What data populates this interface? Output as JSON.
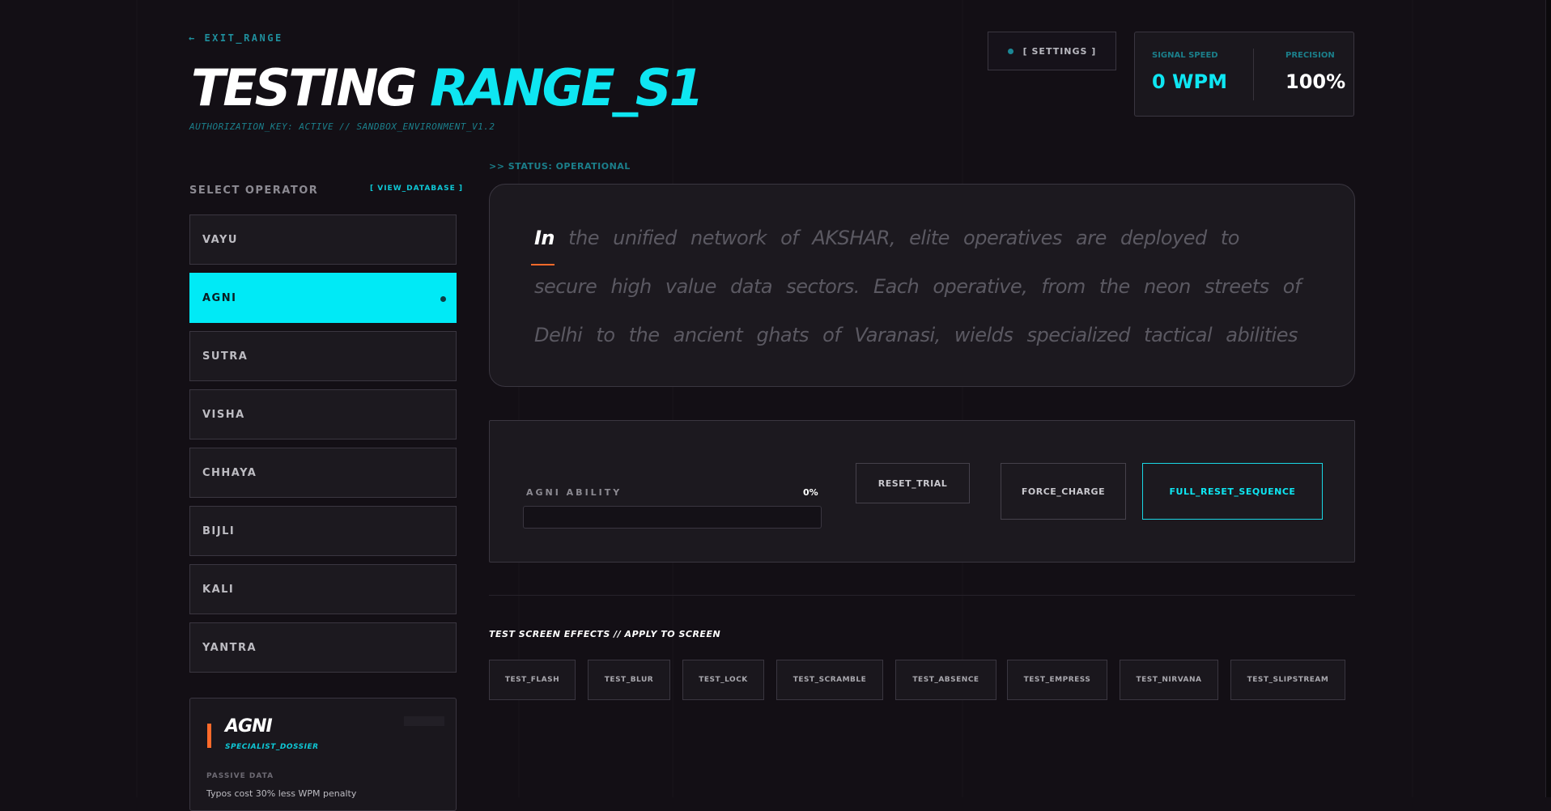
{
  "header": {
    "exit_label": "← EXIT_RANGE",
    "title_white": "TESTING",
    "title_cyan": "RANGE_S1",
    "auth_line": "AUTHORIZATION_KEY: ACTIVE // SANDBOX_ENVIRONMENT_V1.2",
    "settings_label": "[ SETTINGS ]"
  },
  "stats": {
    "speed_label": "SIGNAL SPEED",
    "speed_value": "0 WPM",
    "precision_label": "PRECISION",
    "precision_value": "100%",
    "speed_color": "#0ee6f2",
    "precision_color": "#ffffff"
  },
  "operators": {
    "heading": "SELECT OPERATOR",
    "view_database": "[ VIEW_DATABASE ]",
    "items": [
      {
        "label": "VAYU",
        "active": false
      },
      {
        "label": "AGNI",
        "active": true
      },
      {
        "label": "SUTRA",
        "active": false
      },
      {
        "label": "VISHA",
        "active": false
      },
      {
        "label": "CHHAYA",
        "active": false
      },
      {
        "label": "BIJLI",
        "active": false
      },
      {
        "label": "KALI",
        "active": false
      },
      {
        "label": "YANTRA",
        "active": false
      }
    ],
    "accent_color": "#00eaf6"
  },
  "dossier": {
    "name": "AGNI",
    "subtitle": "SPECIALIST_DOSSIER",
    "passive_label": "PASSIVE DATA",
    "passive_text": "Typos cost 30% less WPM penalty"
  },
  "typing": {
    "status": ">> STATUS: OPERATIONAL",
    "current_word": "In",
    "line1_rest": "the unified network of AKSHAR, elite operatives are deployed to",
    "line2": "secure high value data sectors. Each operative, from the neon streets of",
    "line3": "Delhi to the ancient ghats of Varanasi, wields specialized tactical abilities"
  },
  "controls": {
    "ability_label": "AGNI ABILITY",
    "ability_percent_text": "0%",
    "ability_percent": 0,
    "reset_trial": "RESET_TRIAL",
    "force_charge": "FORCE_CHARGE",
    "full_reset": "FULL_RESET_SEQUENCE"
  },
  "effects": {
    "heading": "TEST SCREEN EFFECTS // APPLY TO SCREEN",
    "buttons": [
      "TEST_FLASH",
      "TEST_BLUR",
      "TEST_LOCK",
      "TEST_SCRAMBLE",
      "TEST_ABSENCE",
      "TEST_EMPRESS",
      "TEST_NIRVANA",
      "TEST_SLIPSTREAM"
    ]
  }
}
